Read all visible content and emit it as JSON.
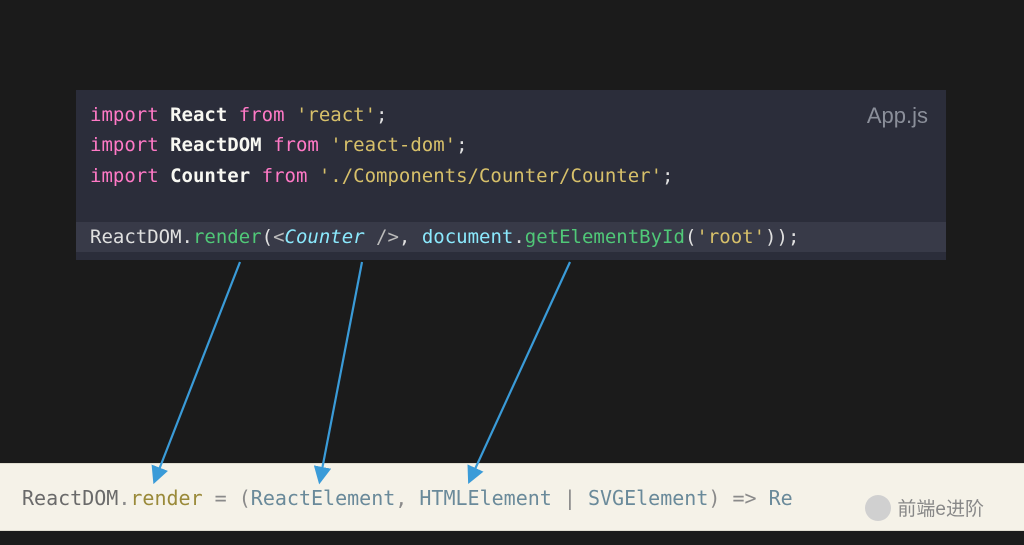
{
  "filename": "App.js",
  "code": {
    "l1": {
      "kw1": "import",
      "id": "React",
      "kw2": "from",
      "str": "'react'",
      "semi": ";"
    },
    "l2": {
      "kw1": "import",
      "id": "ReactDOM",
      "kw2": "from",
      "str": "'react-dom'",
      "semi": ";"
    },
    "l3": {
      "kw1": "import",
      "id": "Counter",
      "kw2": "from",
      "str": "'./Components/Counter/Counter'",
      "semi": ";"
    },
    "l5": {
      "obj": "ReactDOM",
      "dot": ".",
      "method": "render",
      "open": "(",
      "jsxOpen": "<",
      "jsxName": "Counter",
      "jsxClose": " />",
      "comma": ", ",
      "doc": "document",
      "dot2": ".",
      "fn": "getElementById",
      "paren1": "(",
      "arg": "'root'",
      "paren2": ")",
      "close": ")",
      "semi": ";"
    }
  },
  "signature": {
    "obj": "ReactDOM",
    "dot": ".",
    "method": "render",
    "eq": " = ",
    "open": "(",
    "p1": "ReactElement",
    "sep1": ", ",
    "p2": "HTMLElement",
    "pipe": " | ",
    "p3": "SVGElement",
    "close": ")",
    "arrow": " => ",
    "ret_prefix": "Re",
    "ret_suffix": ";"
  },
  "watermark": "前端e进阶"
}
